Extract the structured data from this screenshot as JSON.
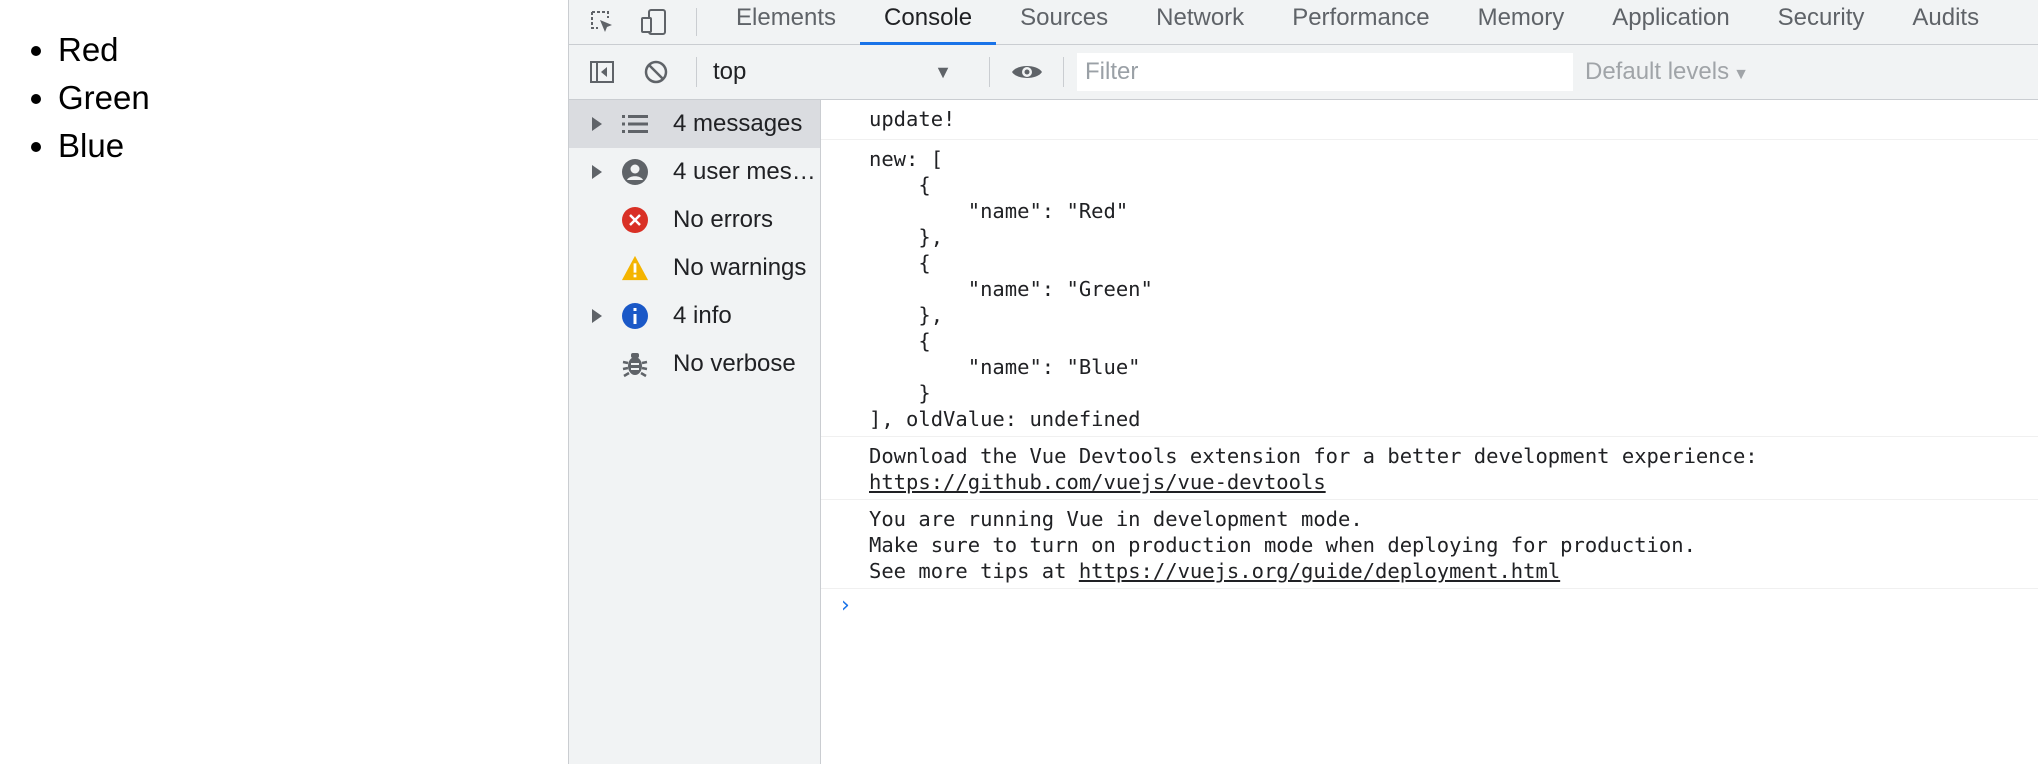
{
  "page": {
    "list_items": [
      "Red",
      "Green",
      "Blue"
    ]
  },
  "devtools": {
    "tabs": [
      "Elements",
      "Console",
      "Sources",
      "Network",
      "Performance",
      "Memory",
      "Application",
      "Security",
      "Audits"
    ],
    "active_tab": "Console",
    "toolbar": {
      "context": "top",
      "filter_placeholder": "Filter",
      "levels": "Default levels"
    },
    "sidebar": [
      {
        "label": "4 messages",
        "icon": "list-icon",
        "expandable": true,
        "selected": true
      },
      {
        "label": "4 user mes…",
        "icon": "user-icon",
        "expandable": true,
        "selected": false
      },
      {
        "label": "No errors",
        "icon": "error-icon",
        "expandable": false,
        "selected": false
      },
      {
        "label": "No warnings",
        "icon": "warning-icon",
        "expandable": false,
        "selected": false
      },
      {
        "label": "4 info",
        "icon": "info-icon",
        "expandable": true,
        "selected": false
      },
      {
        "label": "No verbose",
        "icon": "bug-icon",
        "expandable": false,
        "selected": false
      }
    ],
    "console": {
      "msg1": "update!",
      "msg2_lines": [
        "new: [",
        "    {",
        "        \"name\": \"Red\"",
        "    },",
        "    {",
        "        \"name\": \"Green\"",
        "    },",
        "    {",
        "        \"name\": \"Blue\"",
        "    }",
        "], oldValue: undefined"
      ],
      "msg3_text": "Download the Vue Devtools extension for a better development experience:",
      "msg3_link": "https://github.com/vuejs/vue-devtools",
      "msg4_line1": "You are running Vue in development mode.",
      "msg4_line2": "Make sure to turn on production mode when deploying for production.",
      "msg4_prefix": "See more tips at ",
      "msg4_link": "https://vuejs.org/guide/deployment.html"
    },
    "colors": {
      "accent": "#1a73e8",
      "error": "#d93025",
      "warning": "#f4b400",
      "info": "#1a58c7"
    }
  }
}
